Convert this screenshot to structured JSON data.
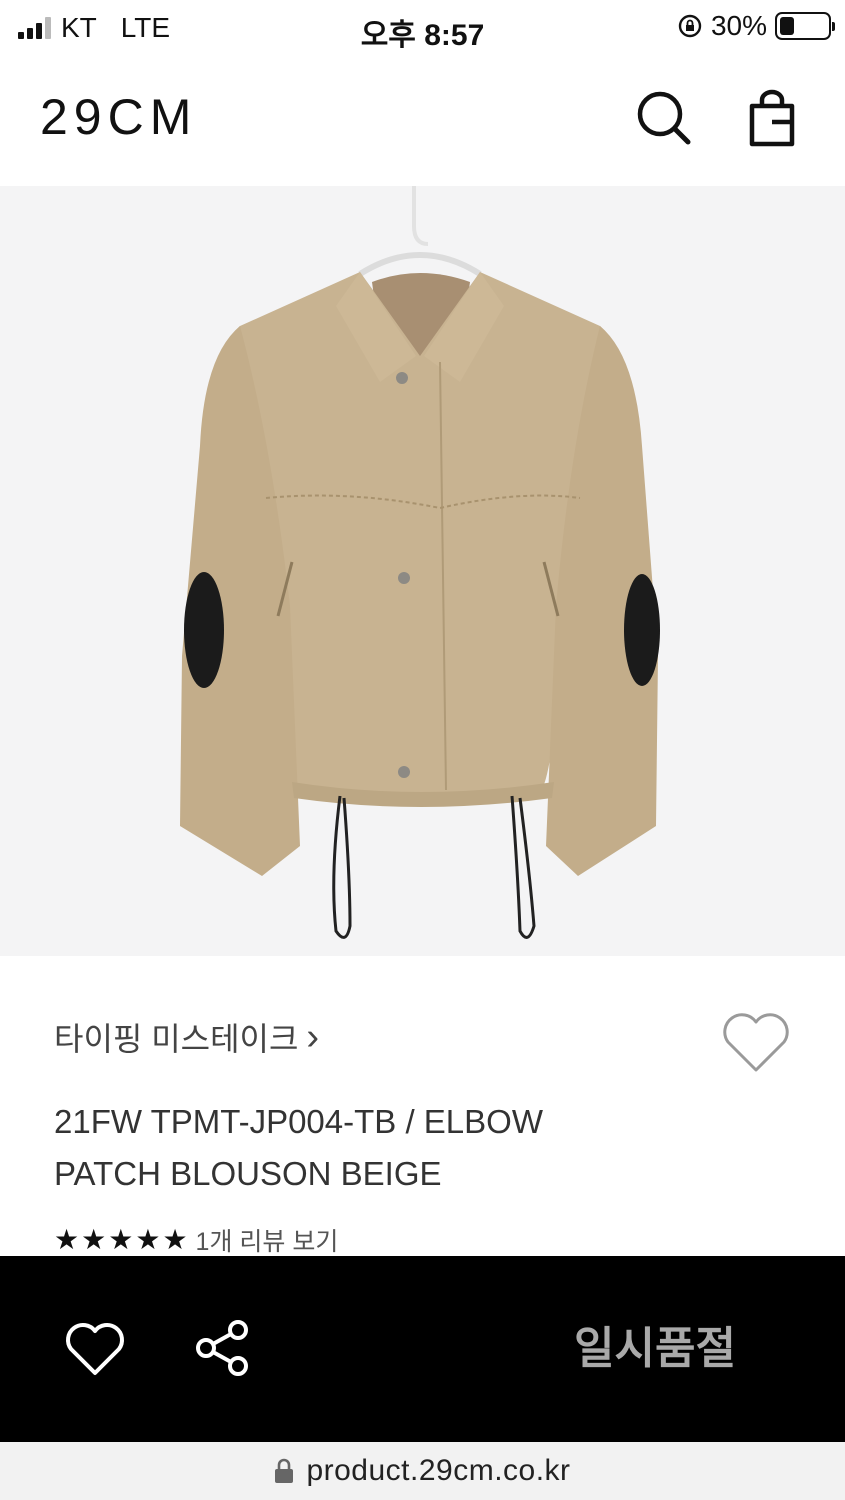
{
  "status_bar": {
    "carrier": "KT",
    "network": "LTE",
    "time": "오후 8:57",
    "battery": "30%",
    "battery_level": 0.3
  },
  "header": {
    "logo": "29CM",
    "icons": [
      "search-icon",
      "shopping-bag-icon"
    ]
  },
  "product": {
    "image": "beige-blouson-jacket",
    "brand": "타이핑 미스테이크",
    "brand_chevron": "›",
    "title_line1": "21FW TPMT-JP004-TB / ELBOW",
    "title_line2": "PATCH BLOUSON BEIGE",
    "rating": 5,
    "rating_max": 5,
    "review_link": "1개 리뷰 보기"
  },
  "action_bar": {
    "status_label": "일시품절",
    "icons": [
      "heart-icon",
      "share-icon"
    ],
    "status_color": "#a9a9a9"
  },
  "url_bar": {
    "url": "product.29cm.co.kr"
  }
}
